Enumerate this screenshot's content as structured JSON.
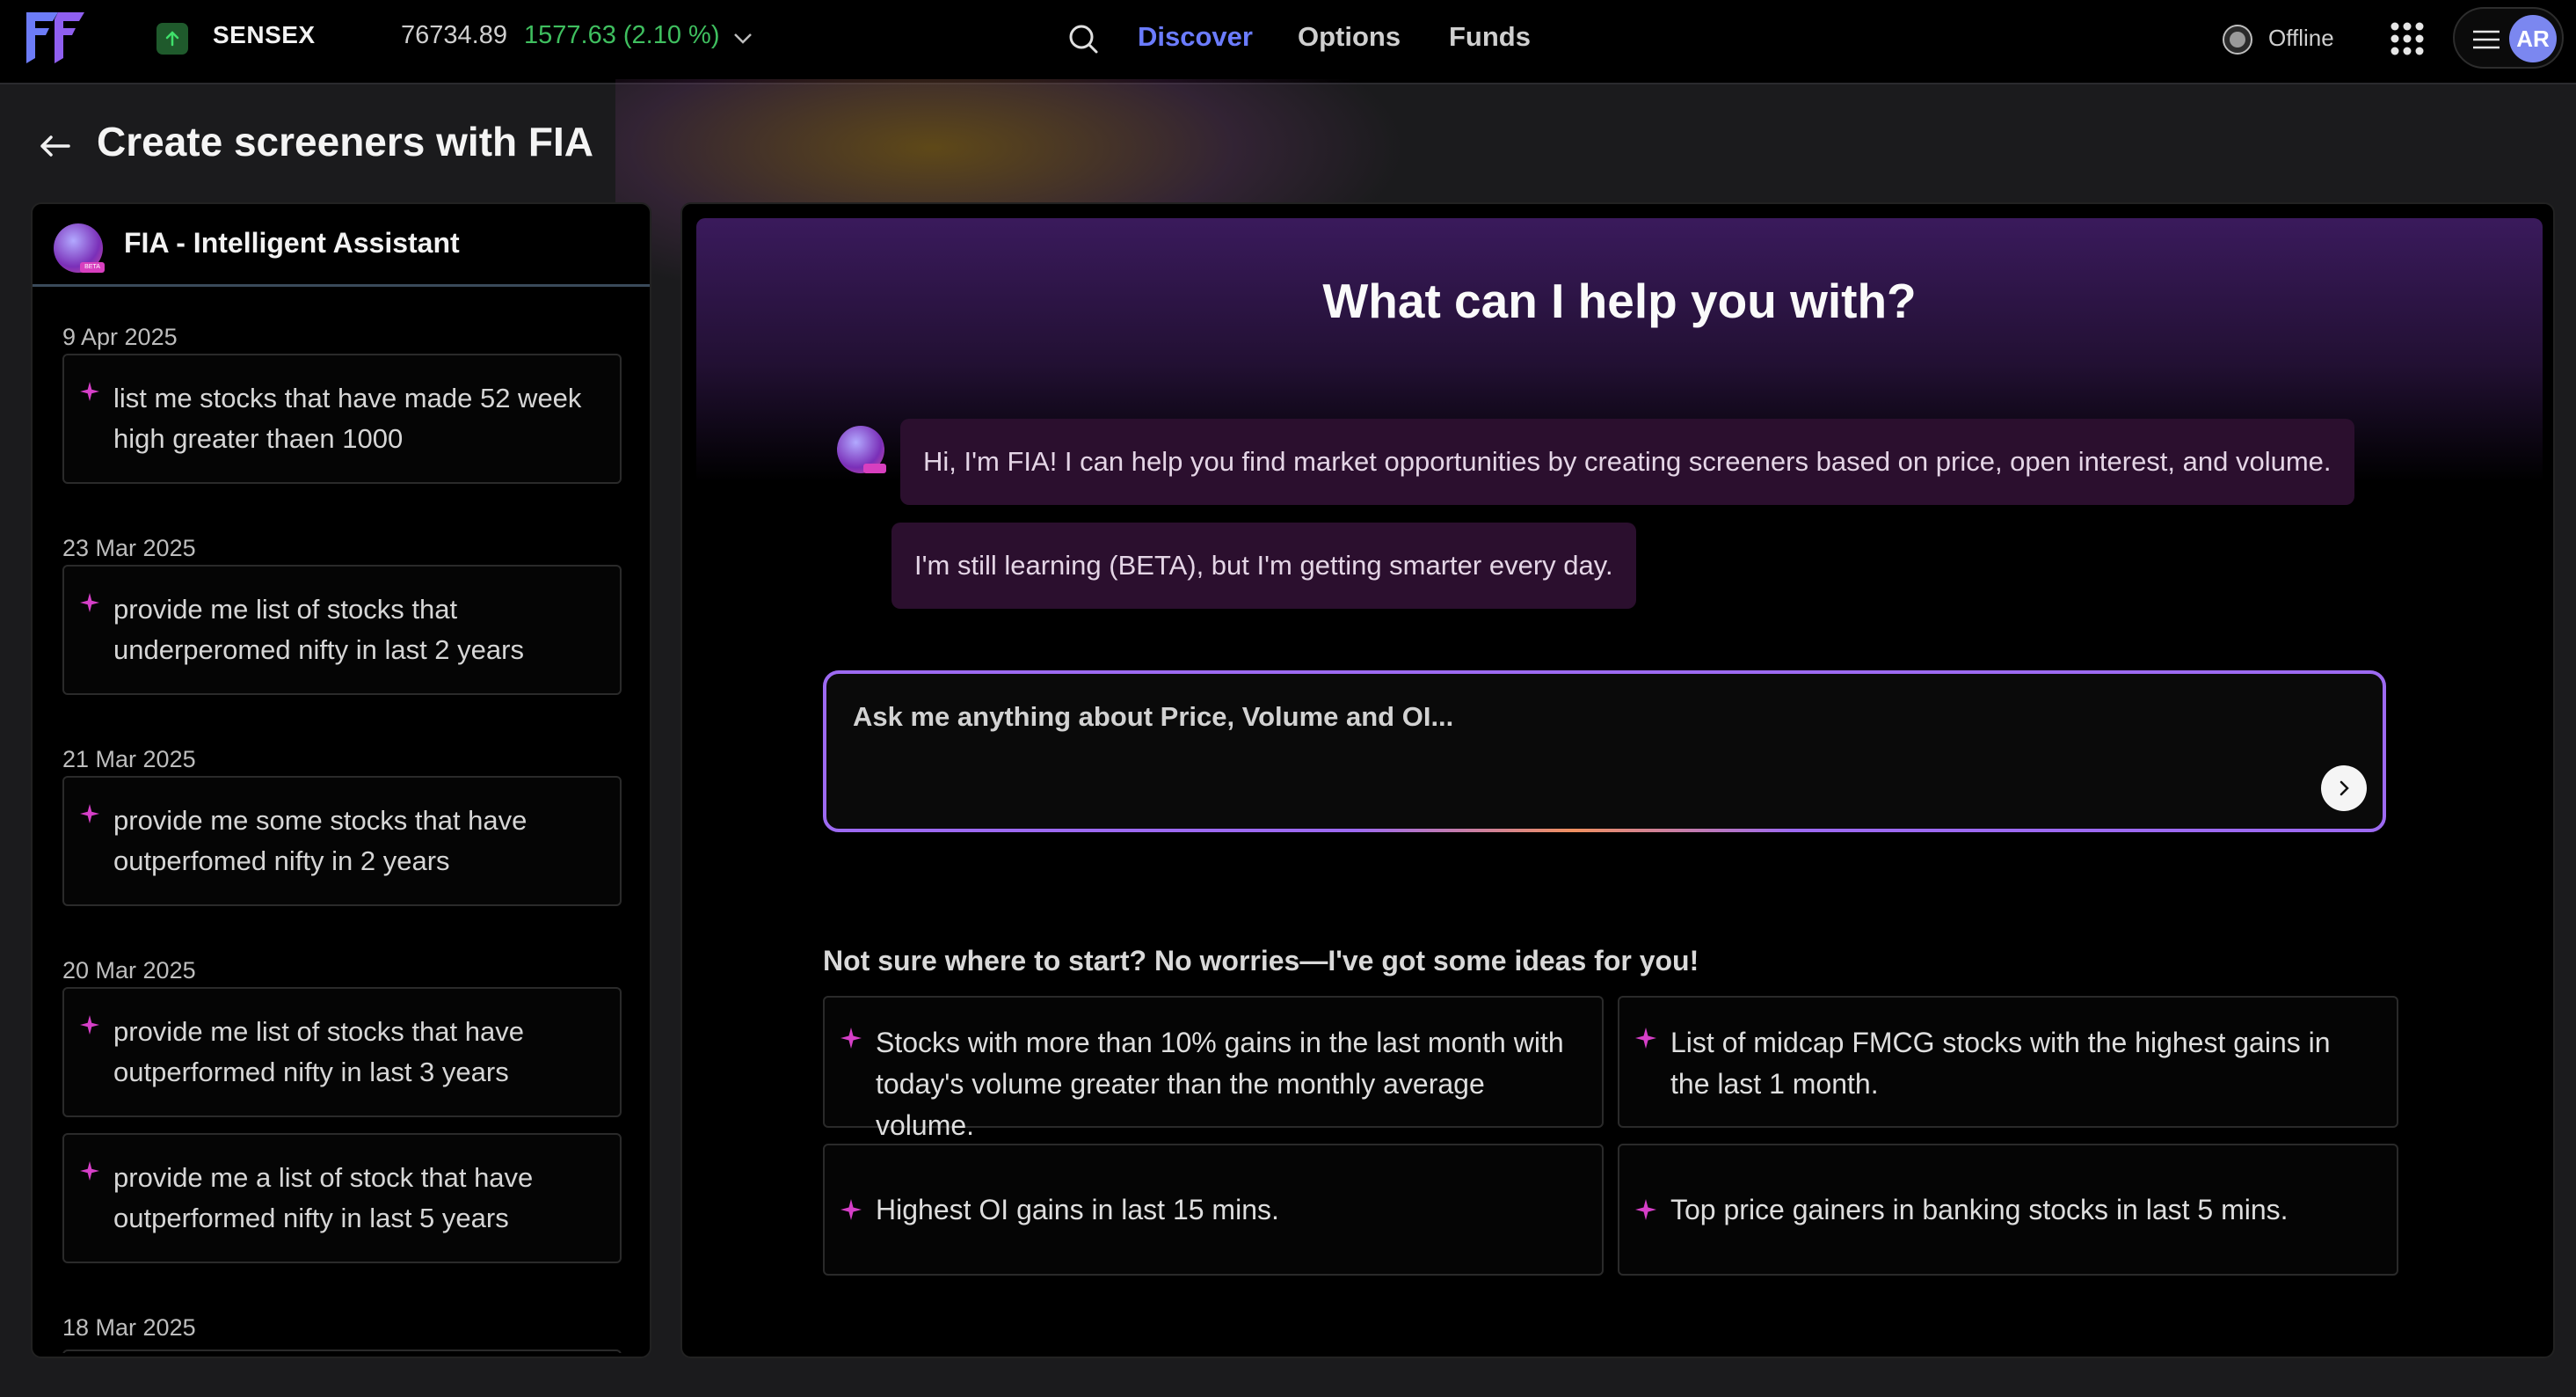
{
  "topbar": {
    "index": {
      "name": "SENSEX",
      "price": "76734.89",
      "change": "1577.63 (2.10 %)"
    },
    "nav": {
      "discover": "Discover",
      "options": "Options",
      "funds": "Funds"
    },
    "status": "Offline",
    "avatar_initials": "AR",
    "colors": {
      "active_nav": "#6b7cff",
      "positive": "#3fbf5f",
      "brand": "#7a5cff"
    }
  },
  "page": {
    "title": "Create screeners with FIA"
  },
  "history": {
    "title": "FIA - Intelligent Assistant",
    "groups": [
      {
        "date": "9 Apr 2025",
        "items": [
          "list me stocks that have made 52 week high greater thaen 1000"
        ]
      },
      {
        "date": "23 Mar 2025",
        "items": [
          "provide me list of stocks that underperomed nifty in last 2 years"
        ]
      },
      {
        "date": "21 Mar 2025",
        "items": [
          "provide me some stocks that have outperfomed nifty in 2 years"
        ]
      },
      {
        "date": "20 Mar 2025",
        "items": [
          "provide me list of stocks that have outperformed nifty in last 3 years",
          "provide me a list of stock that have outperformed nifty in last 5 years"
        ]
      },
      {
        "date": "18 Mar 2025",
        "items": []
      }
    ]
  },
  "chat": {
    "heading": "What can I help you with?",
    "messages": [
      "Hi, I'm FIA! I can help you find market opportunities by creating screeners based on price, open interest, and volume.",
      "I'm still learning (BETA), but I'm getting smarter every day."
    ],
    "input_placeholder": "Ask me anything about Price, Volume and OI...",
    "ideas_title": "Not sure where to start? No worries—I've got some ideas for you!",
    "ideas": [
      "Stocks with more than 10% gains in the last month with today's volume greater than the monthly average volume.",
      "List of midcap FMCG stocks with the highest gains in the last 1 month.",
      "Highest OI gains in last 15 mins.",
      "Top price gainers in banking stocks in last 5 mins."
    ]
  }
}
